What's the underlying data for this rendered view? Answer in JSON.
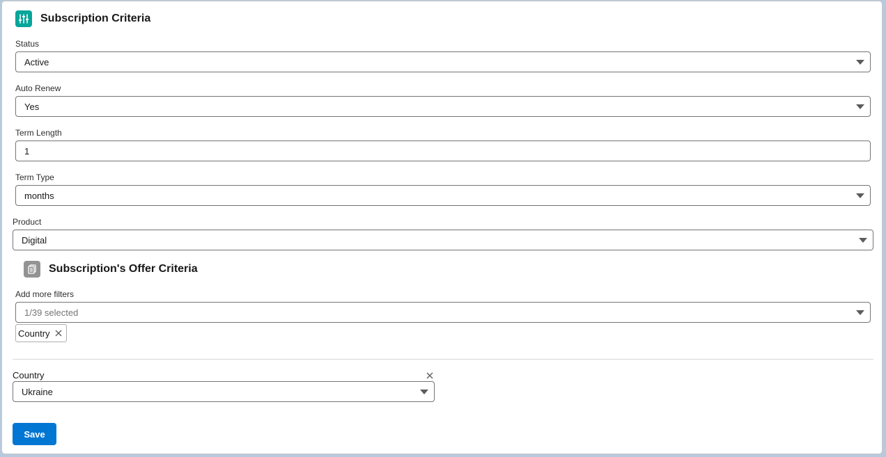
{
  "section1": {
    "title": "Subscription Criteria",
    "icon": "sliders-icon",
    "icon_color": "#06a59a"
  },
  "fields": {
    "status": {
      "label": "Status",
      "value": "Active"
    },
    "auto_renew": {
      "label": "Auto Renew",
      "value": "Yes"
    },
    "term_length": {
      "label": "Term Length",
      "value": "1"
    },
    "term_type": {
      "label": "Term Type",
      "value": "months"
    },
    "product": {
      "label": "Product",
      "value": "Digital"
    }
  },
  "section2": {
    "title": "Subscription's Offer Criteria",
    "icon": "document-icon",
    "icon_color": "#939393"
  },
  "filters": {
    "label": "Add more filters",
    "placeholder": "1/39 selected",
    "selected_pill": "Country"
  },
  "country": {
    "label": "Country",
    "value": "Ukraine"
  },
  "actions": {
    "save_label": "Save",
    "save_color": "#0176d3"
  }
}
